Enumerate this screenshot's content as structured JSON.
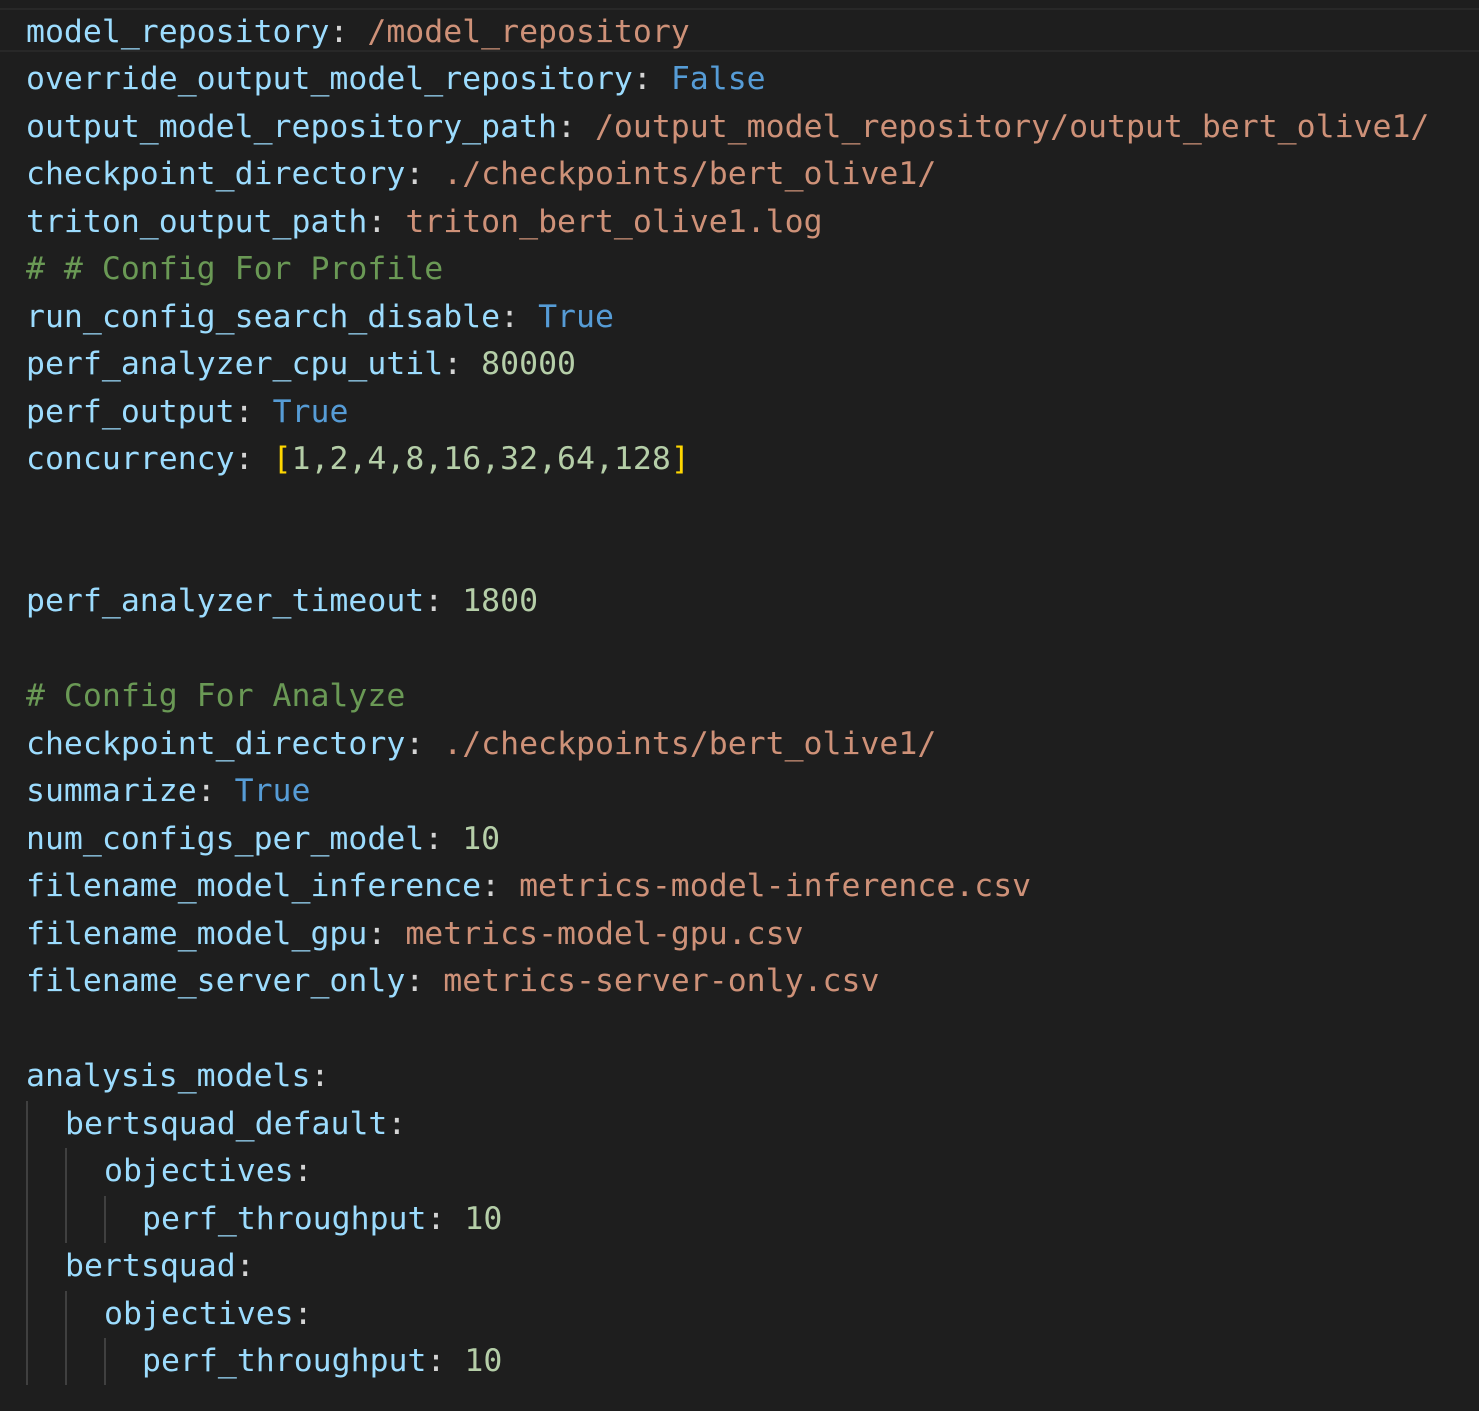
{
  "editor": {
    "language": "yaml",
    "theme_colors": {
      "background": "#1e1e1e",
      "key": "#9cdcfe",
      "string": "#ce9178",
      "keyword": "#569cd6",
      "number": "#b5cea8",
      "comment": "#6a9955",
      "bracket": "#ffd700"
    },
    "lines": [
      {
        "key": "model_repository",
        "value": "/model_repository"
      },
      {
        "key": "override_output_model_repository",
        "value": "False"
      },
      {
        "key": "output_model_repository_path",
        "value": "/output_model_repository/output_bert_olive1/"
      },
      {
        "key": "checkpoint_directory",
        "value": "./checkpoints/bert_olive1/"
      },
      {
        "key": "triton_output_path",
        "value": "triton_bert_olive1.log"
      },
      {
        "comment": "# # Config For Profile"
      },
      {
        "key": "run_config_search_disable",
        "value": "True"
      },
      {
        "key": "perf_analyzer_cpu_util",
        "value": "80000"
      },
      {
        "key": "perf_output",
        "value": "True"
      },
      {
        "key": "concurrency",
        "open": "[",
        "value": "1,2,4,8,16,32,64,128",
        "close": "]"
      },
      {
        "key": "perf_analyzer_timeout",
        "value": "1800"
      },
      {
        "comment": "# Config For Analyze"
      },
      {
        "key": "checkpoint_directory",
        "value": "./checkpoints/bert_olive1/"
      },
      {
        "key": "summarize",
        "value": "True"
      },
      {
        "key": "num_configs_per_model",
        "value": "10"
      },
      {
        "key": "filename_model_inference",
        "value": "metrics-model-inference.csv"
      },
      {
        "key": "filename_model_gpu",
        "value": "metrics-model-gpu.csv"
      },
      {
        "key": "filename_server_only",
        "value": "metrics-server-only.csv"
      },
      {
        "key": "analysis_models"
      },
      {
        "key": "bertsquad_default"
      },
      {
        "key": "objectives"
      },
      {
        "key": "perf_throughput",
        "value": "10"
      },
      {
        "key": "bertsquad"
      },
      {
        "key": "objectives"
      },
      {
        "key": "perf_throughput",
        "value": "10"
      }
    ]
  }
}
